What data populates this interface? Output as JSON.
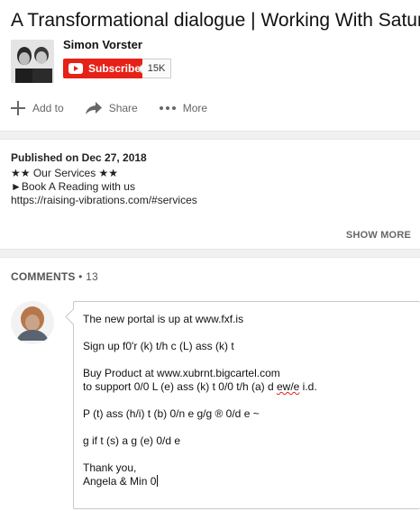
{
  "video": {
    "title": "A Transformational dialogue | Working With Saturn"
  },
  "channel": {
    "name": "Simon Vorster",
    "subscribe_label": "Subscribe",
    "subscriber_count": "15K"
  },
  "actions": {
    "add_label": "Add to",
    "share_label": "Share",
    "more_label": "More"
  },
  "description": {
    "published": "Published on Dec 27, 2018",
    "lines": [
      "★★ Our Services ★★",
      "►Book A Reading with us",
      "https://raising-vibrations.com/#services"
    ],
    "show_more_label": "SHOW MORE"
  },
  "comments": {
    "heading": "COMMENTS",
    "count": " • 13"
  },
  "comment_draft": {
    "lines": [
      "The new portal is up at www.fxf.is",
      "",
      "Sign up f0'r (k) t/h c (L) ass (k) t",
      "",
      "Buy Product at www.xubrnt.bigcartel.com",
      "to support 0/0 L (e) ass (k) t 0/0 t/h (a) d ",
      "",
      "P (t) ass (h/i) t (b) 0/n e g/g ® 0/d e ~",
      "",
      "g if t (s) a g (e) 0/d e",
      "",
      "Thank you,",
      "Angela & Min 0"
    ],
    "misspelled_word": "ew/e",
    "after_misspelled": " i.d."
  },
  "colors": {
    "subscribe_red": "#e62117",
    "divider_gray": "#f1f1f1",
    "text_secondary": "#666666"
  }
}
